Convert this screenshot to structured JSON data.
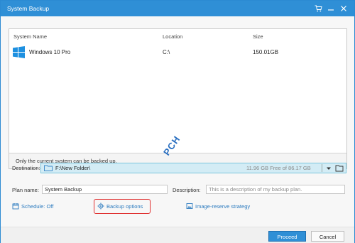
{
  "window": {
    "title": "System Backup"
  },
  "list": {
    "headers": {
      "name": "System Name",
      "location": "Location",
      "size": "Size"
    },
    "rows": [
      {
        "name": "Windows 10 Pro",
        "location": "C:\\",
        "size": "150.01GB"
      }
    ],
    "footer": "Only the current system can be backed up."
  },
  "destination": {
    "label": "Destination:",
    "path": "F:\\New Folder\\",
    "free": "11.96 GB Free of 86.17 GB"
  },
  "plan": {
    "label": "Plan name:",
    "value": "System Backup"
  },
  "description": {
    "label": "Description:",
    "placeholder": "This is a description of my backup plan."
  },
  "options": {
    "schedule": "Schedule: Off",
    "backup_options": "Backup options",
    "image_reserve": "Image-reserve strategy"
  },
  "buttons": {
    "proceed": "Proceed",
    "cancel": "Cancel"
  },
  "watermark": "PCH",
  "colors": {
    "accent": "#2f8fd6",
    "link": "#2c7bbf",
    "highlight": "#e03030",
    "destination_bg": "#d3ecf5"
  }
}
